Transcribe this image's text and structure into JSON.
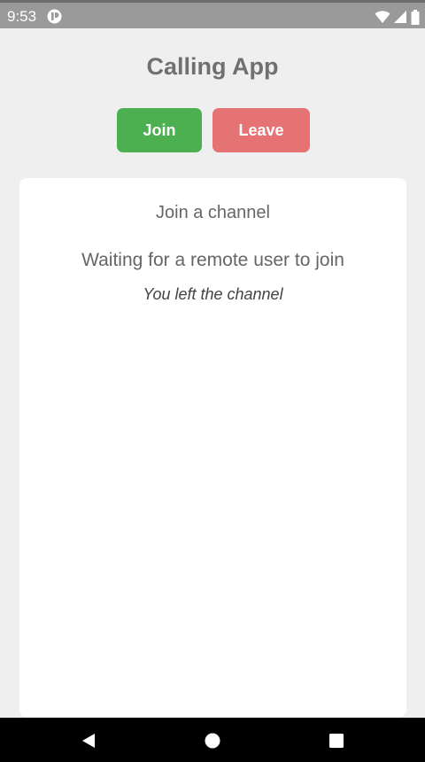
{
  "status_bar": {
    "time": "9:53",
    "icons": [
      "app-notification-icon",
      "wifi-icon",
      "cell-signal-icon",
      "battery-icon"
    ],
    "color": "#9a9a9a"
  },
  "header": {
    "title": "Calling App"
  },
  "actions": {
    "join_label": "Join",
    "leave_label": "Leave",
    "join_color": "#4caf50",
    "leave_color": "#e57373"
  },
  "card": {
    "channel_label": "Join a channel",
    "waiting_text": "Waiting for a remote user to join",
    "status_message": "You left the channel"
  },
  "nav_bar": {
    "buttons": [
      "back-icon",
      "home-icon",
      "recents-icon"
    ]
  }
}
